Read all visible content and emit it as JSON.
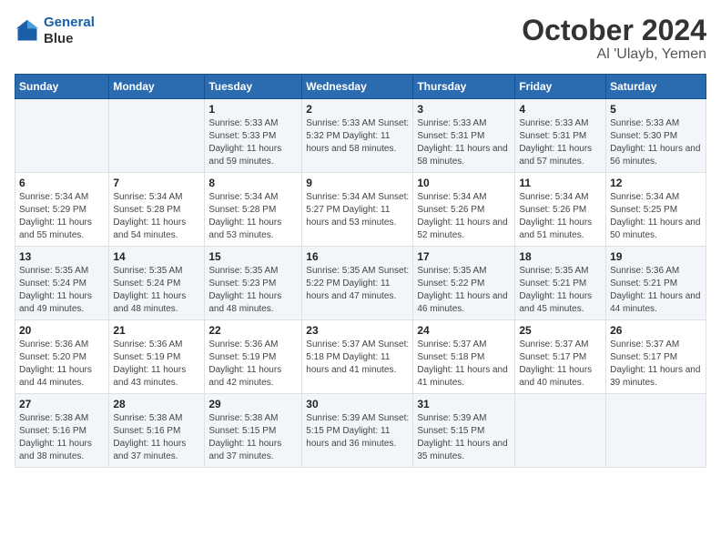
{
  "header": {
    "logo_line1": "General",
    "logo_line2": "Blue",
    "title": "October 2024",
    "subtitle": "Al 'Ulayb, Yemen"
  },
  "days_of_week": [
    "Sunday",
    "Monday",
    "Tuesday",
    "Wednesday",
    "Thursday",
    "Friday",
    "Saturday"
  ],
  "weeks": [
    [
      {
        "day": "",
        "info": ""
      },
      {
        "day": "",
        "info": ""
      },
      {
        "day": "1",
        "info": "Sunrise: 5:33 AM\nSunset: 5:33 PM\nDaylight: 11 hours\nand 59 minutes."
      },
      {
        "day": "2",
        "info": "Sunrise: 5:33 AM\nSunset: 5:32 PM\nDaylight: 11 hours\nand 58 minutes."
      },
      {
        "day": "3",
        "info": "Sunrise: 5:33 AM\nSunset: 5:31 PM\nDaylight: 11 hours\nand 58 minutes."
      },
      {
        "day": "4",
        "info": "Sunrise: 5:33 AM\nSunset: 5:31 PM\nDaylight: 11 hours\nand 57 minutes."
      },
      {
        "day": "5",
        "info": "Sunrise: 5:33 AM\nSunset: 5:30 PM\nDaylight: 11 hours\nand 56 minutes."
      }
    ],
    [
      {
        "day": "6",
        "info": "Sunrise: 5:34 AM\nSunset: 5:29 PM\nDaylight: 11 hours\nand 55 minutes."
      },
      {
        "day": "7",
        "info": "Sunrise: 5:34 AM\nSunset: 5:28 PM\nDaylight: 11 hours\nand 54 minutes."
      },
      {
        "day": "8",
        "info": "Sunrise: 5:34 AM\nSunset: 5:28 PM\nDaylight: 11 hours\nand 53 minutes."
      },
      {
        "day": "9",
        "info": "Sunrise: 5:34 AM\nSunset: 5:27 PM\nDaylight: 11 hours\nand 53 minutes."
      },
      {
        "day": "10",
        "info": "Sunrise: 5:34 AM\nSunset: 5:26 PM\nDaylight: 11 hours\nand 52 minutes."
      },
      {
        "day": "11",
        "info": "Sunrise: 5:34 AM\nSunset: 5:26 PM\nDaylight: 11 hours\nand 51 minutes."
      },
      {
        "day": "12",
        "info": "Sunrise: 5:34 AM\nSunset: 5:25 PM\nDaylight: 11 hours\nand 50 minutes."
      }
    ],
    [
      {
        "day": "13",
        "info": "Sunrise: 5:35 AM\nSunset: 5:24 PM\nDaylight: 11 hours\nand 49 minutes."
      },
      {
        "day": "14",
        "info": "Sunrise: 5:35 AM\nSunset: 5:24 PM\nDaylight: 11 hours\nand 48 minutes."
      },
      {
        "day": "15",
        "info": "Sunrise: 5:35 AM\nSunset: 5:23 PM\nDaylight: 11 hours\nand 48 minutes."
      },
      {
        "day": "16",
        "info": "Sunrise: 5:35 AM\nSunset: 5:22 PM\nDaylight: 11 hours\nand 47 minutes."
      },
      {
        "day": "17",
        "info": "Sunrise: 5:35 AM\nSunset: 5:22 PM\nDaylight: 11 hours\nand 46 minutes."
      },
      {
        "day": "18",
        "info": "Sunrise: 5:35 AM\nSunset: 5:21 PM\nDaylight: 11 hours\nand 45 minutes."
      },
      {
        "day": "19",
        "info": "Sunrise: 5:36 AM\nSunset: 5:21 PM\nDaylight: 11 hours\nand 44 minutes."
      }
    ],
    [
      {
        "day": "20",
        "info": "Sunrise: 5:36 AM\nSunset: 5:20 PM\nDaylight: 11 hours\nand 44 minutes."
      },
      {
        "day": "21",
        "info": "Sunrise: 5:36 AM\nSunset: 5:19 PM\nDaylight: 11 hours\nand 43 minutes."
      },
      {
        "day": "22",
        "info": "Sunrise: 5:36 AM\nSunset: 5:19 PM\nDaylight: 11 hours\nand 42 minutes."
      },
      {
        "day": "23",
        "info": "Sunrise: 5:37 AM\nSunset: 5:18 PM\nDaylight: 11 hours\nand 41 minutes."
      },
      {
        "day": "24",
        "info": "Sunrise: 5:37 AM\nSunset: 5:18 PM\nDaylight: 11 hours\nand 41 minutes."
      },
      {
        "day": "25",
        "info": "Sunrise: 5:37 AM\nSunset: 5:17 PM\nDaylight: 11 hours\nand 40 minutes."
      },
      {
        "day": "26",
        "info": "Sunrise: 5:37 AM\nSunset: 5:17 PM\nDaylight: 11 hours\nand 39 minutes."
      }
    ],
    [
      {
        "day": "27",
        "info": "Sunrise: 5:38 AM\nSunset: 5:16 PM\nDaylight: 11 hours\nand 38 minutes."
      },
      {
        "day": "28",
        "info": "Sunrise: 5:38 AM\nSunset: 5:16 PM\nDaylight: 11 hours\nand 37 minutes."
      },
      {
        "day": "29",
        "info": "Sunrise: 5:38 AM\nSunset: 5:15 PM\nDaylight: 11 hours\nand 37 minutes."
      },
      {
        "day": "30",
        "info": "Sunrise: 5:39 AM\nSunset: 5:15 PM\nDaylight: 11 hours\nand 36 minutes."
      },
      {
        "day": "31",
        "info": "Sunrise: 5:39 AM\nSunset: 5:15 PM\nDaylight: 11 hours\nand 35 minutes."
      },
      {
        "day": "",
        "info": ""
      },
      {
        "day": "",
        "info": ""
      }
    ]
  ]
}
